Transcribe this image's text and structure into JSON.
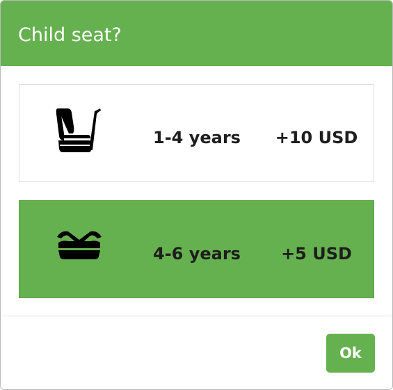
{
  "dialog": {
    "title": "Child seat?",
    "options": [
      {
        "icon": "infant-car-seat-icon",
        "age": "1-4 years",
        "price": "+10 USD",
        "selected": false
      },
      {
        "icon": "booster-seat-icon",
        "age": "4-6 years",
        "price": "+5 USD",
        "selected": true
      }
    ],
    "ok_label": "Ok"
  },
  "colors": {
    "accent": "#66b14f",
    "text": "#1e1e1e",
    "border": "#dedede"
  }
}
